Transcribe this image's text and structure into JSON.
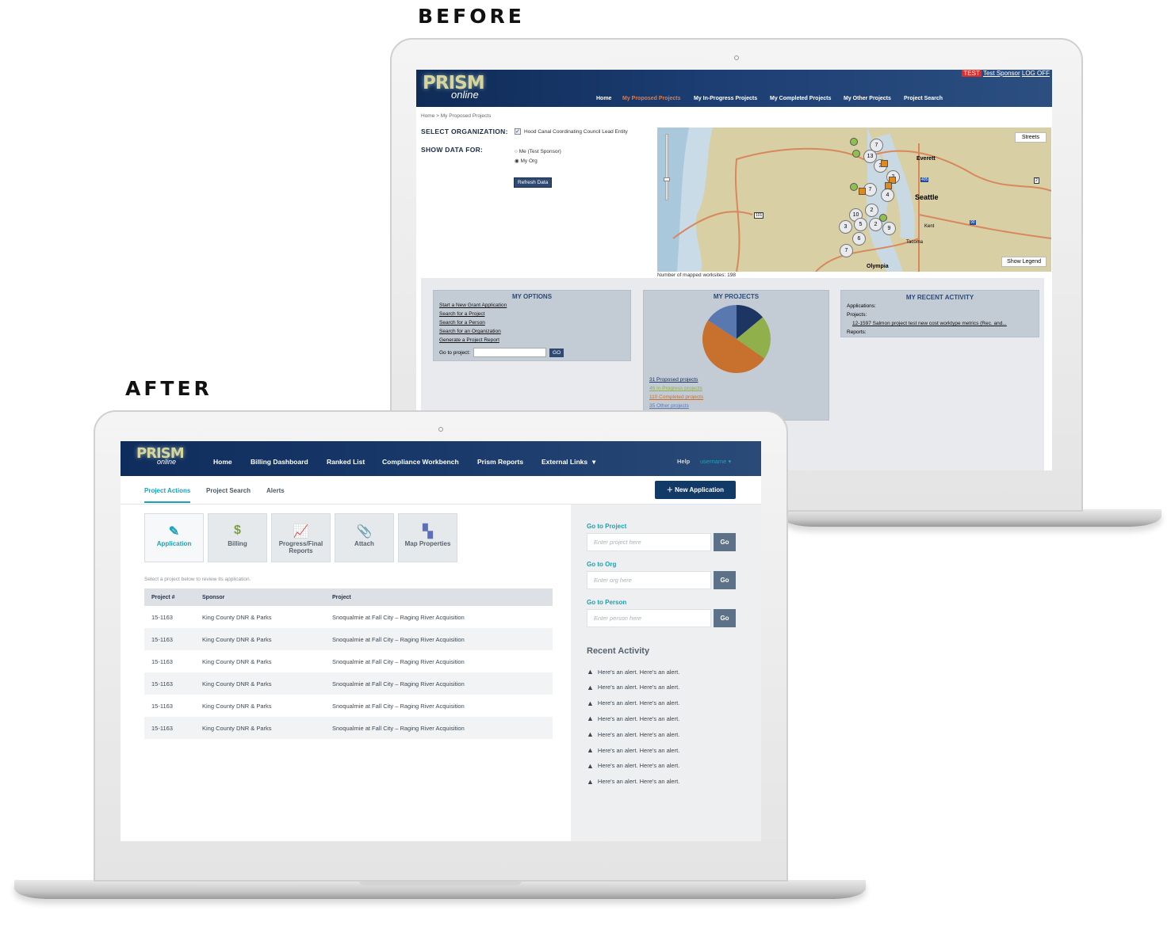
{
  "labels": {
    "before": "BEFORE",
    "after": "AFTER"
  },
  "before": {
    "logo": {
      "main": "PRISM",
      "sub": "online"
    },
    "top_links": {
      "badge": "TEST",
      "user": "Test Sponsor",
      "logoff": "LOG OFF"
    },
    "nav": [
      {
        "label": "Home",
        "active": false
      },
      {
        "label": "My Proposed Projects",
        "active": true
      },
      {
        "label": "My In-Progress Projects",
        "active": false
      },
      {
        "label": "My Completed Projects",
        "active": false
      },
      {
        "label": "My Other Projects",
        "active": false
      },
      {
        "label": "Project Search",
        "active": false
      }
    ],
    "breadcrumb": "Home > My Proposed Projects",
    "select_org_label": "SELECT ORGANIZATION:",
    "org_option": "Hood Canal Coordinating Council Lead Entity",
    "org_checked": true,
    "show_data_label": "SHOW DATA FOR:",
    "radios": [
      {
        "label": "Me (Test Sponsor)",
        "checked": false
      },
      {
        "label": "My Org",
        "checked": true
      }
    ],
    "refresh_button": "Refresh Data",
    "map": {
      "streets_button": "Streets",
      "legend_button": "Show Legend",
      "places": [
        "Everett",
        "Seattle",
        "Kent",
        "Tacoma",
        "Olympia"
      ],
      "shields": [
        "405",
        "101",
        "90",
        "2"
      ],
      "cluster_counts": [
        "7",
        "13",
        "3",
        "2",
        "4",
        "7",
        "2",
        "10",
        "3",
        "5",
        "2",
        "9",
        "6",
        "7"
      ],
      "worksites_text": "Number of mapped worksites: 198"
    },
    "options": {
      "title": "MY OPTIONS",
      "links": [
        "Start a New Grant Application",
        "Search for a Project",
        "Search for a Person",
        "Search for an Organization",
        "Generate a Project Report"
      ],
      "go_label": "Go to project:",
      "go_value": "",
      "go_button": "GO"
    },
    "projects": {
      "title": "MY PROJECTS",
      "slices": [
        {
          "label": "31 Proposed projects",
          "value": 31,
          "color": "#1c3563"
        },
        {
          "label": "46 In Progress projects",
          "value": 46,
          "color": "#8fb04a"
        },
        {
          "label": "110 Completed projects",
          "value": 110,
          "color": "#c8702e"
        },
        {
          "label": "35 Other projects",
          "value": 35,
          "color": "#5a78b0"
        }
      ]
    },
    "activity": {
      "title": "MY RECENT ACTIVITY",
      "applications": "Applications:",
      "projects": "Projects:",
      "project_link": "12-1597 Salmon project test new cost worktype metrics (Rec. and...",
      "reports": "Reports:"
    }
  },
  "after": {
    "logo": {
      "main": "PRISM",
      "sub": "online"
    },
    "nav": [
      "Home",
      "Billing Dashboard",
      "Ranked List",
      "Compliance Workbench",
      "Prism Reports",
      "External Links"
    ],
    "help": "Help",
    "username": "username",
    "tabs": [
      {
        "label": "Project Actions",
        "active": true
      },
      {
        "label": "Project Search",
        "active": false
      },
      {
        "label": "Alerts",
        "active": false
      }
    ],
    "new_app_button": "New Application",
    "tiles": [
      {
        "label": "Application",
        "icon": "edit-icon",
        "color": "#1aa3b6",
        "active": true
      },
      {
        "label": "Billing",
        "icon": "dollar-icon",
        "color": "#7ba03c",
        "active": false
      },
      {
        "label": "Progress/Final Reports",
        "icon": "chart-line-icon",
        "color": "#2b6fb5",
        "active": false
      },
      {
        "label": "Attach",
        "icon": "paperclip-icon",
        "color": "#e8793a",
        "active": false
      },
      {
        "label": "Map Properties",
        "icon": "map-icon",
        "color": "#5a6fc0",
        "active": false
      }
    ],
    "hint": "Select a project below to review its application.",
    "table": {
      "headers": [
        "Project #",
        "Sponsor",
        "Project"
      ],
      "rows": [
        [
          "15-1163",
          "King County DNR & Parks",
          "Snoqualmie at Fall City – Raging River Acquisition"
        ],
        [
          "15-1163",
          "King County DNR & Parks",
          "Snoqualmie at Fall City – Raging River Acquisition"
        ],
        [
          "15-1163",
          "King County DNR & Parks",
          "Snoqualmie at Fall City – Raging River Acquisition"
        ],
        [
          "15-1163",
          "King County DNR & Parks",
          "Snoqualmie at Fall City – Raging River Acquisition"
        ],
        [
          "15-1163",
          "King County DNR & Parks",
          "Snoqualmie at Fall City – Raging River Acquisition"
        ],
        [
          "15-1163",
          "King County DNR & Parks",
          "Snoqualmie at Fall City – Raging River Acquisition"
        ]
      ]
    },
    "go_fields": [
      {
        "label": "Go to Project",
        "placeholder": "Enter project here",
        "button": "Go"
      },
      {
        "label": "Go to Org",
        "placeholder": "Enter org here",
        "button": "Go"
      },
      {
        "label": "Go to Person",
        "placeholder": "Enter person here",
        "button": "Go"
      }
    ],
    "recent_title": "Recent Activity",
    "alerts": [
      "Here's an alert. Here's an alert.",
      "Here's an alert. Here's an alert.",
      "Here's an alert. Here's an alert.",
      "Here's an alert. Here's an alert.",
      "Here's an alert. Here's an alert.",
      "Here's an alert. Here's an alert.",
      "Here's an alert. Here's an alert.",
      "Here's an alert. Here's an alert."
    ]
  },
  "colors": {
    "navy": "#0f2b57",
    "accent_orange": "#e8793a",
    "teal": "#1aa3b6",
    "test_red": "#e52a2a"
  }
}
